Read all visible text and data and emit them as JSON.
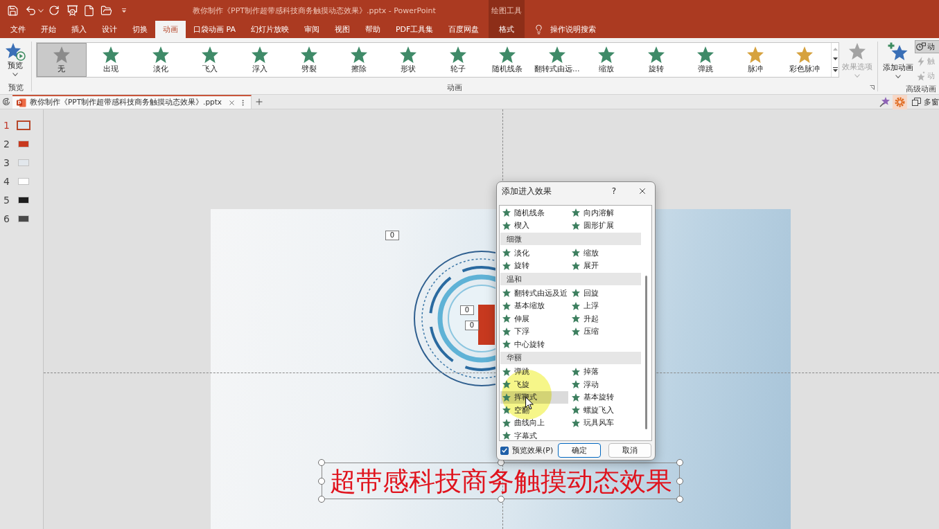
{
  "window": {
    "title": "教你制作《PPT制作超带感科技商务触摸动态效果》.pptx - PowerPoint"
  },
  "tabs": [
    {
      "label": "文件",
      "selected": false
    },
    {
      "label": "开始",
      "selected": false
    },
    {
      "label": "插入",
      "selected": false
    },
    {
      "label": "设计",
      "selected": false
    },
    {
      "label": "切换",
      "selected": false
    },
    {
      "label": "动画",
      "selected": true
    },
    {
      "label": "口袋动画 PA",
      "selected": false
    },
    {
      "label": "幻灯片放映",
      "selected": false
    },
    {
      "label": "审阅",
      "selected": false
    },
    {
      "label": "视图",
      "selected": false
    },
    {
      "label": "帮助",
      "selected": false
    },
    {
      "label": "PDF工具集",
      "selected": false
    },
    {
      "label": "百度网盘",
      "selected": false
    }
  ],
  "context_group": {
    "label": "绘图工具",
    "tab": {
      "label": "格式",
      "selected": false
    }
  },
  "tell_me": {
    "label": "操作说明搜索"
  },
  "ribbon": {
    "preview": {
      "label": "预览",
      "group_label": "预览"
    },
    "animation_gallery": {
      "group_label": "动画",
      "items": [
        {
          "label": "无",
          "kind": "none",
          "selected": true
        },
        {
          "label": "出现",
          "kind": "entrance",
          "selected": false
        },
        {
          "label": "淡化",
          "kind": "entrance",
          "selected": false
        },
        {
          "label": "飞入",
          "kind": "entrance",
          "selected": false
        },
        {
          "label": "浮入",
          "kind": "entrance",
          "selected": false
        },
        {
          "label": "劈裂",
          "kind": "entrance",
          "selected": false
        },
        {
          "label": "擦除",
          "kind": "entrance",
          "selected": false
        },
        {
          "label": "形状",
          "kind": "entrance",
          "selected": false
        },
        {
          "label": "轮子",
          "kind": "entrance",
          "selected": false
        },
        {
          "label": "随机线条",
          "kind": "entrance",
          "selected": false
        },
        {
          "label": "翻转式由远...",
          "kind": "entrance",
          "selected": false
        },
        {
          "label": "缩放",
          "kind": "entrance",
          "selected": false
        },
        {
          "label": "旋转",
          "kind": "entrance",
          "selected": false
        },
        {
          "label": "弹跳",
          "kind": "entrance",
          "selected": false
        },
        {
          "label": "脉冲",
          "kind": "emphasis",
          "selected": false
        },
        {
          "label": "彩色脉冲",
          "kind": "emphasis",
          "selected": false
        }
      ]
    },
    "effect_options": {
      "label": "效果选项",
      "disabled": true
    },
    "advanced": {
      "group_label": "高级动画",
      "add_animation": {
        "label": "添加动画"
      },
      "small_buttons": [
        {
          "kind": "pane",
          "label": "动",
          "on": true,
          "disabled": false
        },
        {
          "kind": "trigger",
          "label": "触",
          "on": false,
          "disabled": true
        },
        {
          "kind": "painter",
          "label": "动",
          "on": false,
          "disabled": true
        }
      ]
    }
  },
  "document_tabs": [
    {
      "label": "教你制作《PPT制作超带感科技商务触摸动态效果》.pptx",
      "selected": true
    }
  ],
  "window_menu": {
    "label": "多窗"
  },
  "slides": [
    {
      "number": "1",
      "selected": true,
      "color": "#dbe5ec"
    },
    {
      "number": "2",
      "selected": false,
      "color": "#c8391f"
    },
    {
      "number": "3",
      "selected": false,
      "color": "#e2e7ec"
    },
    {
      "number": "4",
      "selected": false,
      "color": "#ffffff"
    },
    {
      "number": "5",
      "selected": false,
      "color": "#1e1e1e"
    },
    {
      "number": "6",
      "selected": false,
      "color": "#4a4a4a"
    }
  ],
  "slide": {
    "animation_tags": [
      "0",
      "0",
      "0"
    ],
    "text_box": {
      "text": "超带感科技商务触摸动态效果",
      "selected": true
    }
  },
  "dialog": {
    "title": "添加进入效果",
    "help": "?",
    "sections": [
      {
        "items": [
          {
            "label": "随机线条",
            "selected": false
          },
          {
            "label": "向内溶解",
            "selected": false
          },
          {
            "label": "楔入",
            "selected": false
          },
          {
            "label": "圆形扩展",
            "selected": false
          }
        ]
      },
      {
        "heading": "细微",
        "items": [
          {
            "label": "淡化",
            "selected": false
          },
          {
            "label": "缩放",
            "selected": false
          },
          {
            "label": "旋转",
            "selected": false
          },
          {
            "label": "展开",
            "selected": false
          }
        ]
      },
      {
        "heading": "温和",
        "items": [
          {
            "label": "翻转式由远及近",
            "selected": false
          },
          {
            "label": "回旋",
            "selected": false
          },
          {
            "label": "基本缩放",
            "selected": false
          },
          {
            "label": "上浮",
            "selected": false
          },
          {
            "label": "伸展",
            "selected": false
          },
          {
            "label": "升起",
            "selected": false
          },
          {
            "label": "下浮",
            "selected": false
          },
          {
            "label": "压缩",
            "selected": false
          },
          {
            "label": "中心旋转",
            "selected": false
          }
        ]
      },
      {
        "heading": "华丽",
        "items": [
          {
            "label": "弹跳",
            "selected": false
          },
          {
            "label": "掉落",
            "selected": false
          },
          {
            "label": "飞旋",
            "selected": false
          },
          {
            "label": "浮动",
            "selected": false
          },
          {
            "label": "挥鞭式",
            "selected": true
          },
          {
            "label": "基本旋转",
            "selected": false
          },
          {
            "label": "空翻",
            "selected": false
          },
          {
            "label": "螺旋飞入",
            "selected": false
          },
          {
            "label": "曲线向上",
            "selected": false
          },
          {
            "label": "玩具风车",
            "selected": false
          },
          {
            "label": "字幕式",
            "selected": false
          }
        ]
      }
    ],
    "preview_option": {
      "label": "预览效果(P)",
      "checked": true
    },
    "buttons": [
      {
        "label": "确定",
        "kind": "default"
      },
      {
        "label": "取消",
        "kind": "normal"
      }
    ]
  }
}
